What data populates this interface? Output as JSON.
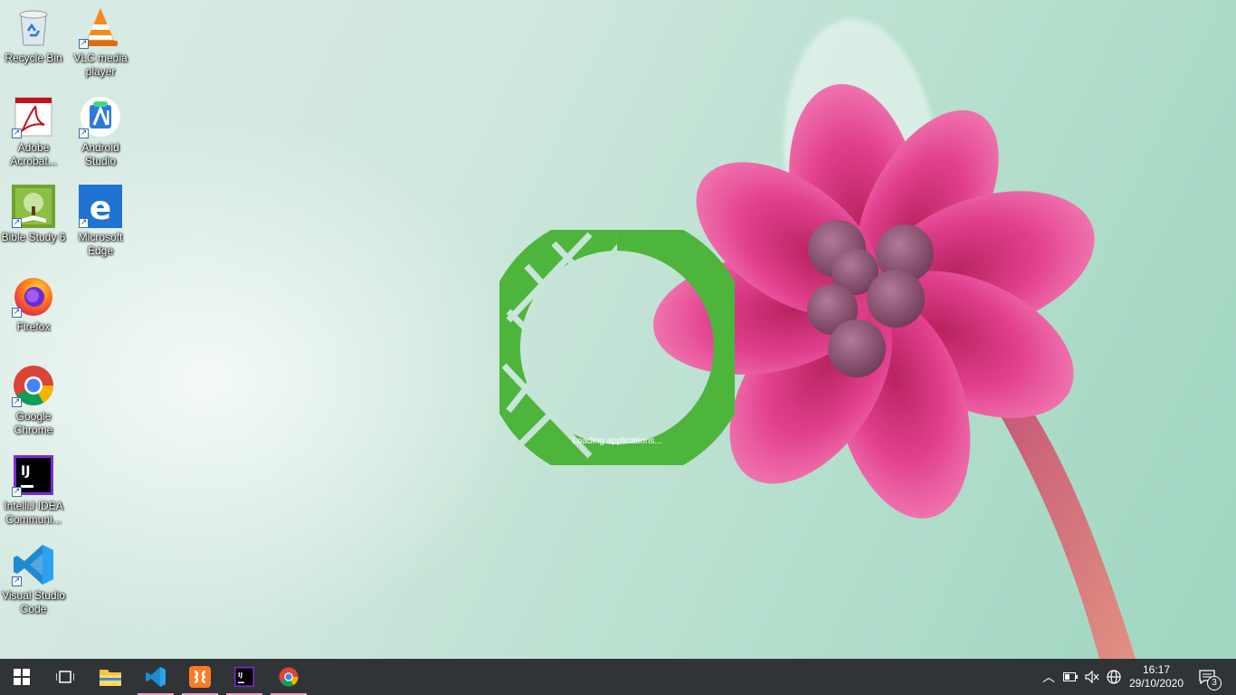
{
  "desktop": {
    "icons": [
      {
        "label": "Recycle Bin",
        "icon": "recycle-bin-icon"
      },
      {
        "label": "VLC media player",
        "icon": "vlc-icon"
      },
      {
        "label": "Adobe Acrobat...",
        "icon": "adobe-acrobat-icon"
      },
      {
        "label": "Android Studio",
        "icon": "android-studio-icon"
      },
      {
        "label": "Bible Study 6",
        "icon": "bible-study-icon"
      },
      {
        "label": "Microsoft Edge",
        "icon": "edge-icon"
      },
      {
        "label": "Firefox",
        "icon": "firefox-icon"
      },
      {
        "label": "Google Chrome",
        "icon": "chrome-icon"
      },
      {
        "label": "IntelliJ IDEA Communi...",
        "icon": "intellij-icon"
      },
      {
        "label": "Visual Studio Code",
        "icon": "vscode-icon"
      }
    ]
  },
  "splash": {
    "text": "Loading applications...",
    "color": "#4db53c"
  },
  "taskbar": {
    "start_icon": "windows-start-icon",
    "task_view_icon": "task-view-icon",
    "pinned": [
      {
        "icon": "file-explorer-icon",
        "running": false
      },
      {
        "icon": "vscode-icon",
        "running": true
      },
      {
        "icon": "xampp-icon",
        "running": true
      },
      {
        "icon": "intellij-icon",
        "running": true
      },
      {
        "icon": "chrome-icon",
        "running": true
      }
    ],
    "tray": {
      "chevron_icon": "chevron-up-icon",
      "battery_icon": "battery-icon",
      "volume_icon": "volume-muted-icon",
      "network_icon": "globe-icon",
      "time": "16:17",
      "date": "29/10/2020",
      "notification_icon": "action-center-icon",
      "notification_count": "3"
    }
  },
  "colors": {
    "taskbar": "#303437",
    "flower": "#e2408f",
    "running_indicator": "#e6a3c8"
  }
}
